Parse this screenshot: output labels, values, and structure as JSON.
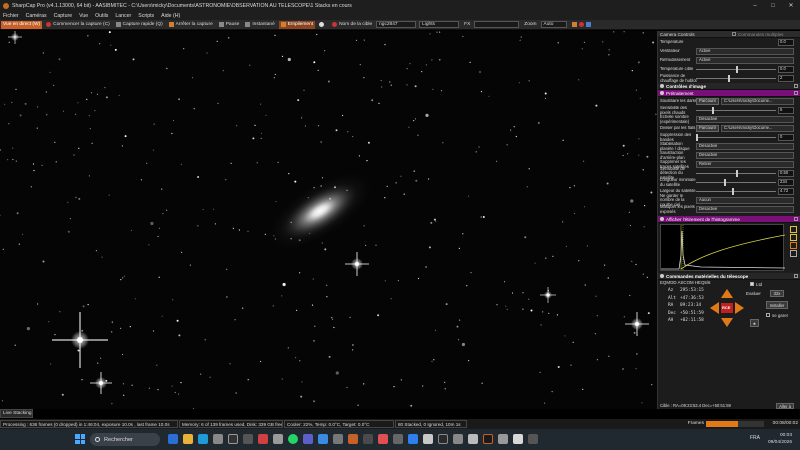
{
  "window": {
    "title": "SharpCap Pro (v4.1.13000, 64 bit) - AASIBMITEC - C:\\Users\\micky\\Documents\\ASTRONOMIE\\OBSERVATION AU TELESCOPE\\1 Stacks en cours",
    "min_glyph": "–",
    "max_glyph": "□",
    "close_glyph": "✕"
  },
  "menu": [
    "Fichier",
    "Caméras",
    "Capture",
    "Vue",
    "Outils",
    "Lancer",
    "Scripts",
    "Aide (H)"
  ],
  "toolbar": {
    "live_view": "Vue en direct (W)",
    "start_capture": "Commencer la capture (C)",
    "quick_capture": "Capture rapide (Q)",
    "stop_capture": "Arrêter la capture",
    "pause": "Pause",
    "snapshot": "Instantané",
    "stacking": "Empilement",
    "target_label": "Nom de la cible",
    "target_value": "ngc2847",
    "frame_type": "Lights",
    "fx_label": "FX",
    "fx_value": "",
    "zoom_label": "Zoom",
    "zoom_value": "Auto"
  },
  "panel": {
    "camera_controls": "Camera Controls",
    "controls_check": "Commandes multiples",
    "rows_camera": [
      {
        "label": "Température",
        "kind": "value",
        "value": "0.0"
      },
      {
        "label": "Ventilateur",
        "kind": "select",
        "value": "Activé"
      },
      {
        "label": "Refroidissement",
        "kind": "select",
        "value": "Activé"
      },
      {
        "label": "Température cible",
        "kind": "slider",
        "value": "0.0",
        "fraction": 0.5
      },
      {
        "label": "Puissance de chauffage de hublot",
        "kind": "slider",
        "value": "2",
        "fraction": 0.4
      }
    ],
    "image_controls": "Contrôles d'image",
    "preprocessing": "Prétraitement",
    "rows_pre": [
      {
        "label": "Soustraire les darks",
        "kind": "path",
        "button": "Parcourir",
        "value": "C:\\Users\\micky\\Docume..."
      },
      {
        "label": "Sensibilité des pixels chauds",
        "kind": "slider",
        "value": "5",
        "fraction": 0.2
      },
      {
        "label": "Echelle sombre (expérimentale)",
        "kind": "select",
        "value": "Désactivé"
      },
      {
        "label": "Diviser par les flats",
        "kind": "path",
        "button": "Parcourir",
        "value": "C:\\Users\\micky\\Docume..."
      },
      {
        "label": "Suppression des bandes",
        "kind": "slider",
        "value": "0",
        "fraction": 0.0
      },
      {
        "label": "Stabilisation planète / disque",
        "kind": "select",
        "value": "Désactivé"
      },
      {
        "label": "Soustraction d'arrière-plan",
        "kind": "select",
        "value": "Désactivé"
      },
      {
        "label": "Supprimer les traces satellites",
        "kind": "select",
        "value": "Retirer"
      },
      {
        "label": "Sensibilité de détection du satellite",
        "kind": "slider",
        "value": "0.50",
        "fraction": 0.5
      },
      {
        "label": "Longueur minimale du satellite",
        "kind": "slider",
        "value": "234",
        "fraction": 0.35
      },
      {
        "label": "Largeur du satellite",
        "kind": "slider",
        "value": "4.72",
        "fraction": 0.45
      },
      {
        "label": "Ne garder le nombre de la courbe ciel",
        "kind": "select",
        "value": "Aucun"
      },
      {
        "label": "Masquer les pixels exposés",
        "kind": "select",
        "value": "Désactivé"
      }
    ],
    "histogram_title": "Afficher l'étirement de l'histogramme",
    "scope_title": "Commandes matérielles du télescope",
    "scope_model": "EQMOD ASCOM HEQ5/6",
    "coords": [
      {
        "k": "Az",
        "v": "295:53:15"
      },
      {
        "k": "Alt",
        "v": "+47:36:53"
      },
      {
        "k": "RA",
        "v": "09:23:34"
      },
      {
        "k": "Dec",
        "v": "+50:51:59"
      },
      {
        "k": "AH",
        "v": "+02:11:58"
      }
    ],
    "scope_slew": "Evaluer",
    "scope_rate": "32x",
    "scope_install": "Installer",
    "scope_park": "se garer",
    "scope_track": "Ltd",
    "scope_footer": "Cible : RA=09:23:53.4 Dec=+50:51:59",
    "scope_stop": "Aller à",
    "center_label": "RCE"
  },
  "status": {
    "live_tab": "Live Stacking",
    "processing": "Processing : 636 frames (0 dropped) in 1:46:04, exposure 10.0s , last frame 10.0s",
    "memory": "Memory: 6 of 139 frames used, Disk: 339 GB free",
    "cooler": "Cooler: 22%, Temp: 0.0°C, Target: 0.0°C",
    "stacked": "80 Stacked, 0 Ignored, 10m 1s",
    "frames_label": "Frames",
    "frames_progress": 0.55,
    "elapsed": "00:08/00:02"
  },
  "taskbar": {
    "search": "Rechercher",
    "time": "00:03",
    "date": "09/04/2026",
    "lang": "FRA"
  },
  "colors": {
    "accent_orange": "#e07a18",
    "panel_purple": "#7a0f7a"
  }
}
